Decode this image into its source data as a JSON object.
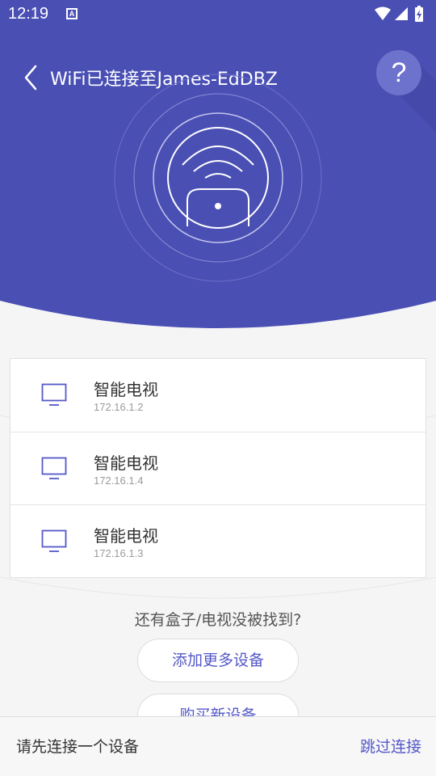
{
  "status": {
    "time": "12:19",
    "notif_letter": "A"
  },
  "header": {
    "title": "WiFi已连接至James-EdDBZ",
    "help": "?"
  },
  "devices": [
    {
      "name": "智能电视",
      "ip": "172.16.1.2"
    },
    {
      "name": "智能电视",
      "ip": "172.16.1.4"
    },
    {
      "name": "智能电视",
      "ip": "172.16.1.3"
    }
  ],
  "prompt": "还有盒子/电视没被找到?",
  "buttons": {
    "add_more": "添加更多设备",
    "buy_new": "购买新设备"
  },
  "bottom": {
    "hint": "请先连接一个设备",
    "skip": "跳过连接"
  },
  "colors": {
    "primary": "#4a4fb4",
    "accent": "#5558c8"
  }
}
